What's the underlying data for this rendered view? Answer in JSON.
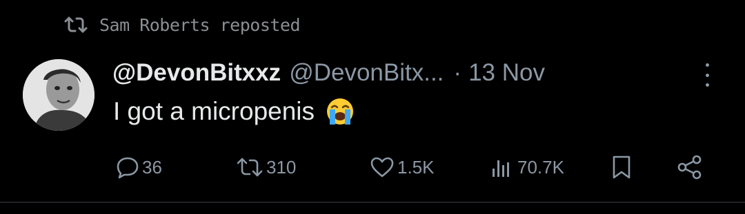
{
  "repost": {
    "icon": "repost-icon",
    "text": "Sam Roberts reposted"
  },
  "tweet": {
    "display_name": "@DevonBitxxz",
    "handle": "@DevonBitx...",
    "separator": "·",
    "date": "13 Nov",
    "text": "I got a micropenis",
    "emoji": "loudly-crying-face"
  },
  "actions": {
    "replies": "36",
    "reposts": "310",
    "likes": "1.5K",
    "views": "70.7K"
  },
  "colors": {
    "background": "#000000",
    "primary_text": "#e7e9ea",
    "secondary_text": "#8b98a5"
  }
}
